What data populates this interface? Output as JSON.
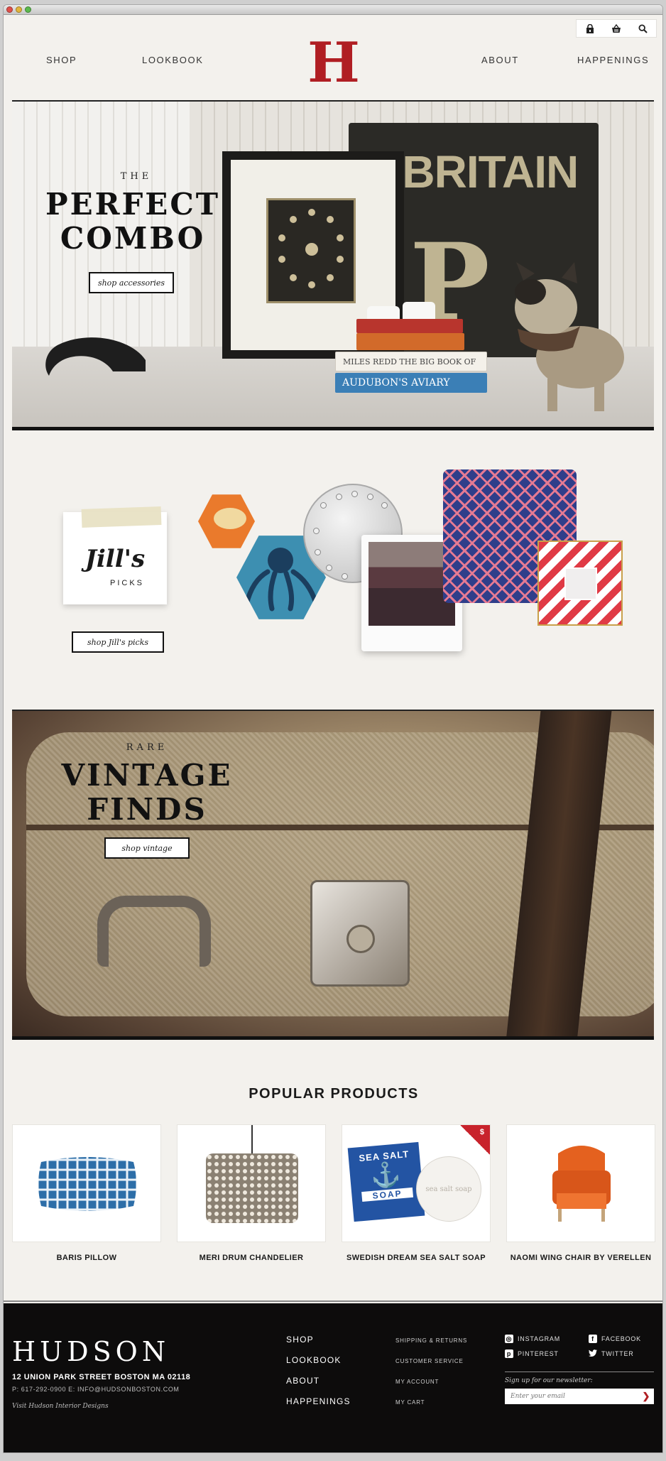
{
  "colors": {
    "brand_red": "#b01e23",
    "background": "#f3f1ed",
    "footer_bg": "#0d0c0c"
  },
  "header": {
    "logo": "H",
    "nav_left": [
      "SHOP",
      "LOOKBOOK"
    ],
    "nav_right": [
      "ABOUT",
      "HAPPENINGS"
    ],
    "utility_icons": [
      "lock-icon",
      "basket-icon",
      "search-icon"
    ]
  },
  "hero_combo": {
    "kicker": "THE",
    "title_line1": "PERFECT",
    "title_line2": "COMBO",
    "cta": "shop accessories",
    "sign_text": "WBRITAIN",
    "books": [
      "MILES REDD THE BIG BOOK OF CHIC",
      "AUDUBON'S AVIARY"
    ]
  },
  "jills_picks": {
    "note_script": "Jill's",
    "note_sub": "PICKS",
    "cta": "shop Jill's picks"
  },
  "hero_vintage": {
    "kicker": "RARE",
    "title_line1": "VINTAGE",
    "title_line2": "FINDS",
    "cta": "shop vintage"
  },
  "popular": {
    "title": "POPULAR PRODUCTS",
    "products": [
      {
        "name": "BARIS PILLOW"
      },
      {
        "name": "MERI DRUM CHANDELIER"
      },
      {
        "name": "SWEDISH DREAM SEA SALT SOAP",
        "badge": "$",
        "box_line1": "SEA",
        "box_line2": "SALT",
        "box_line3": "SOAP",
        "bar_text": "sea salt soap"
      },
      {
        "name": "NAOMI WING CHAIR BY VERELLEN"
      }
    ]
  },
  "footer": {
    "brand": "HUDSON",
    "address": "12 UNION PARK STREET BOSTON MA 02118",
    "contact": "P: 617-292-0900  E: INFO@HUDSONBOSTON.COM",
    "visit": "Visit Hudson Interior Designs",
    "nav": [
      "SHOP",
      "LOOKBOOK",
      "ABOUT",
      "HAPPENINGS"
    ],
    "links": [
      "SHIPPING & RETURNS",
      "CUSTOMER SERVICE",
      "MY ACCOUNT",
      "MY CART"
    ],
    "social": [
      "INSTAGRAM",
      "FACEBOOK",
      "PINTEREST",
      "TWITTER"
    ],
    "newsletter_label": "Sign up for our newsletter:",
    "newsletter_placeholder": "Enter your email"
  }
}
